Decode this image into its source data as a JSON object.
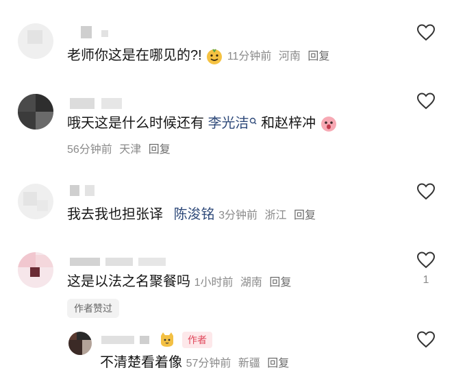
{
  "comments": [
    {
      "text": "老师你这是在哪见的?!",
      "time": "11分钟前",
      "location": "河南",
      "reply": "回复"
    },
    {
      "text_before": "哦天这是什么时候还有",
      "mention": "李光洁",
      "text_after": "和赵梓冲",
      "time": "56分钟前",
      "location": "天津",
      "reply": "回复"
    },
    {
      "text": "我去我也担张译",
      "mention": "陈浚铭",
      "time": "3分钟前",
      "location": "浙江",
      "reply": "回复"
    },
    {
      "text": "这是以法之名聚餐吗",
      "time": "1小时前",
      "location": "湖南",
      "reply": "回复",
      "like_count": "1",
      "author_liked": "作者赞过"
    }
  ],
  "reply_comment": {
    "author_tag": "作者",
    "text": "不清楚看着像",
    "time": "57分钟前",
    "location": "新疆",
    "reply": "回复"
  },
  "icons": {
    "like": "heart-outline-icon",
    "search": "search-icon"
  }
}
